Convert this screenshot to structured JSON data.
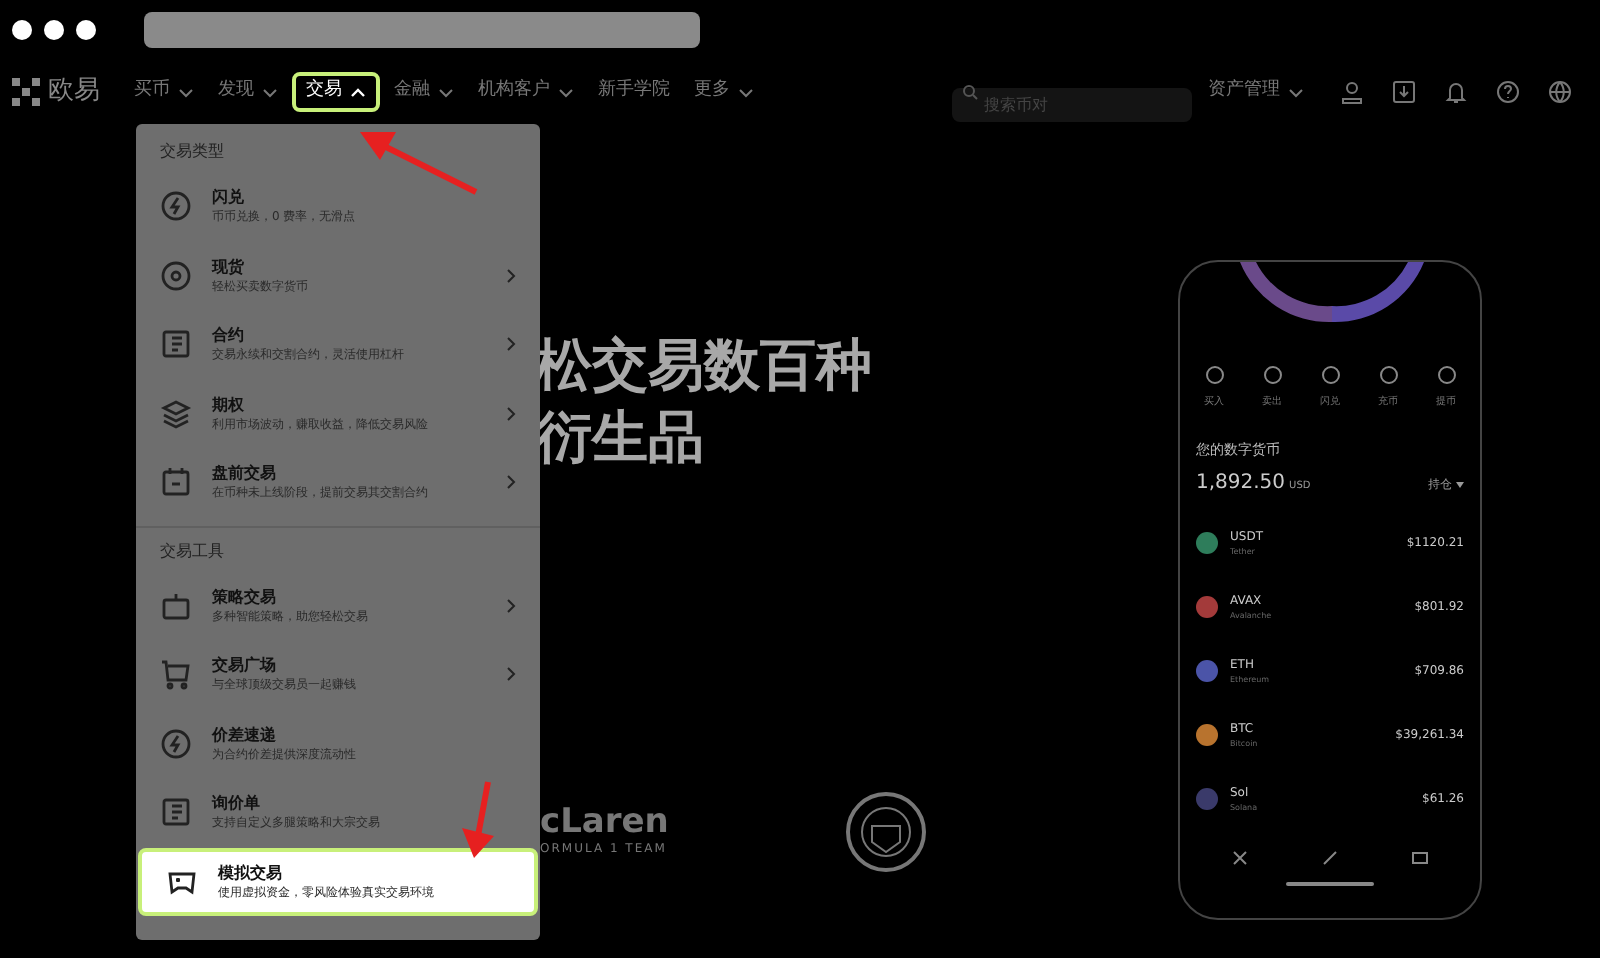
{
  "logo": "欧易",
  "nav": [
    {
      "label": "买币",
      "caret": true,
      "selected": false
    },
    {
      "label": "发现",
      "caret": true,
      "selected": false
    },
    {
      "label": "交易",
      "caret": true,
      "selected": true
    },
    {
      "label": "金融",
      "caret": true,
      "selected": false
    },
    {
      "label": "机构客户",
      "caret": true,
      "selected": false
    },
    {
      "label": "新手学院",
      "caret": false,
      "selected": false
    },
    {
      "label": "更多",
      "caret": true,
      "selected": false
    }
  ],
  "search": {
    "placeholder": "搜索币对"
  },
  "asset_menu": "资产管理",
  "dropdown": {
    "sections": [
      {
        "title": "交易类型",
        "items": [
          {
            "title": "闪兑",
            "subtitle": "币币兑换，0 费率，无滑点",
            "chevron": false,
            "selected": false
          },
          {
            "title": "现货",
            "subtitle": "轻松买卖数字货币",
            "chevron": true,
            "selected": false
          },
          {
            "title": "合约",
            "subtitle": "交易永续和交割合约，灵活使用杠杆",
            "chevron": true,
            "selected": false
          },
          {
            "title": "期权",
            "subtitle": "利用市场波动，赚取收益，降低交易风险",
            "chevron": true,
            "selected": false
          },
          {
            "title": "盘前交易",
            "subtitle": "在币种未上线阶段，提前交易其交割合约",
            "chevron": true,
            "selected": false
          }
        ]
      },
      {
        "title": "交易工具",
        "items": [
          {
            "title": "策略交易",
            "subtitle": "多种智能策略，助您轻松交易",
            "chevron": true,
            "selected": false
          },
          {
            "title": "交易广场",
            "subtitle": "与全球顶级交易员一起赚钱",
            "chevron": true,
            "selected": false
          },
          {
            "title": "价差速递",
            "subtitle": "为合约价差提供深度流动性",
            "chevron": false,
            "selected": false
          },
          {
            "title": "询价单",
            "subtitle": "支持自定义多腿策略和大宗交易",
            "chevron": false,
            "selected": false
          },
          {
            "title": "模拟交易",
            "subtitle": "使用虚拟资金，零风险体验真实交易环境",
            "chevron": false,
            "selected": true
          }
        ]
      }
    ]
  },
  "hero": [
    "松交易数百种",
    "衍生品"
  ],
  "partner": {
    "name": "cLaren",
    "sub": "ORMULA 1 TEAM"
  },
  "phone": {
    "actions": [
      "买入",
      "卖出",
      "闪兑",
      "充币",
      "提币"
    ],
    "heading": "您的数字货币",
    "balance": "1,892.50",
    "currency": "USD",
    "filter": "持仓",
    "coins": [
      {
        "symbol": "USDT",
        "name": "Tether",
        "value": "$1120.21",
        "color": "#2e7d5b"
      },
      {
        "symbol": "AVAX",
        "name": "Avalanche",
        "value": "$801.92",
        "color": "#a33a3a"
      },
      {
        "symbol": "ETH",
        "name": "Ethereum",
        "value": "$709.86",
        "color": "#4b54a8"
      },
      {
        "symbol": "BTC",
        "name": "Bitcoin",
        "value": "$39,261.34",
        "color": "#b8732e"
      },
      {
        "symbol": "Sol",
        "name": "Solana",
        "value": "$61.26",
        "color": "#3a3a6a"
      }
    ]
  }
}
